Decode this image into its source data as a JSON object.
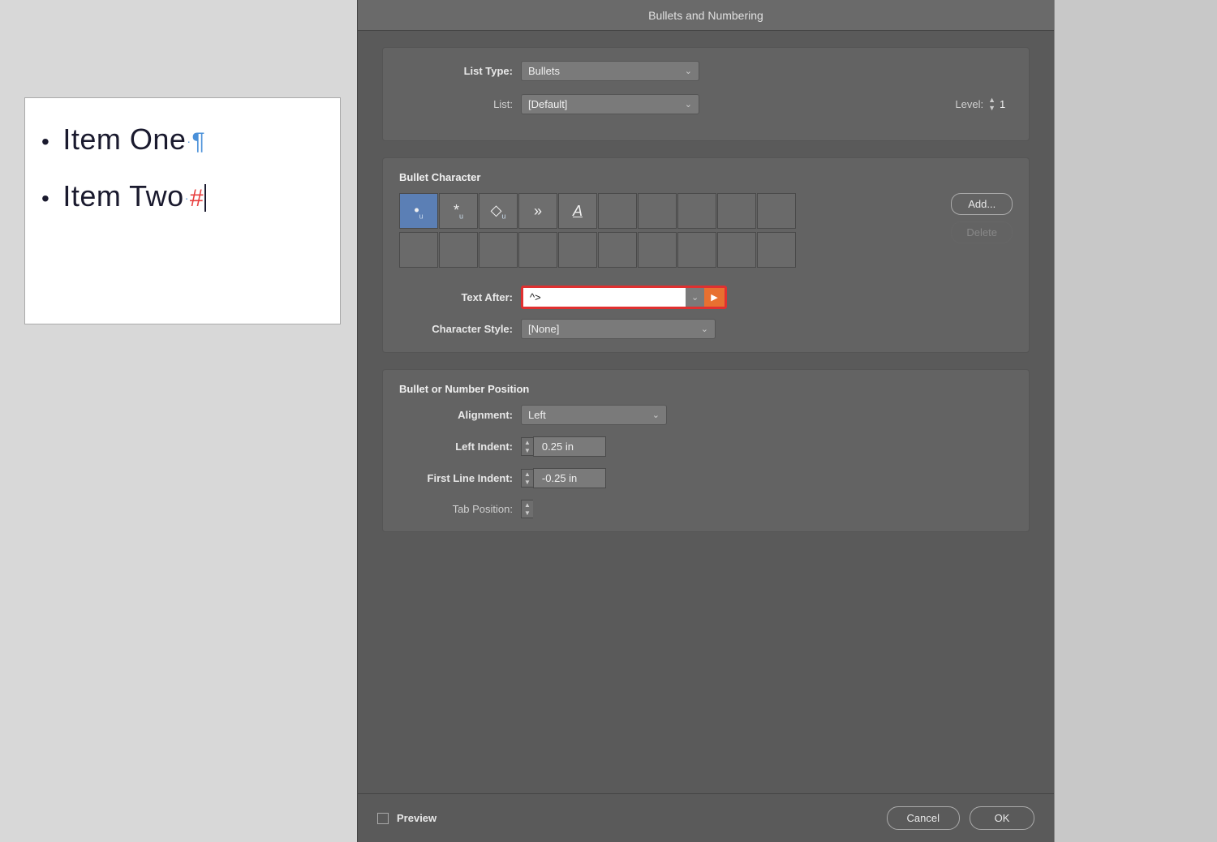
{
  "dialog": {
    "title": "Bullets and Numbering"
  },
  "listType": {
    "label": "List Type:",
    "value": "Bullets"
  },
  "list": {
    "label": "List:",
    "value": "[Default]"
  },
  "level": {
    "label": "Level:",
    "value": "1"
  },
  "bulletCharacter": {
    "title": "Bullet Character",
    "cells": [
      {
        "char": "•",
        "sub": "u",
        "active": true
      },
      {
        "char": "*",
        "sub": "u",
        "active": false
      },
      {
        "char": "◇",
        "sub": "u",
        "active": false
      },
      {
        "char": "»",
        "sub": "",
        "active": false
      },
      {
        "char": "A",
        "sub": "",
        "active": false
      },
      {
        "char": "",
        "active": false
      },
      {
        "char": "",
        "active": false
      },
      {
        "char": "",
        "active": false
      },
      {
        "char": "",
        "active": false
      },
      {
        "char": "",
        "active": false
      },
      {
        "char": "",
        "active": false
      },
      {
        "char": "",
        "active": false
      },
      {
        "char": "",
        "active": false
      },
      {
        "char": "",
        "active": false
      },
      {
        "char": "",
        "active": false
      },
      {
        "char": "",
        "active": false
      },
      {
        "char": "",
        "active": false
      },
      {
        "char": "",
        "active": false
      },
      {
        "char": "",
        "active": false
      },
      {
        "char": "",
        "active": false
      }
    ],
    "addButton": "Add...",
    "deleteButton": "Delete"
  },
  "textAfter": {
    "label": "Text After:",
    "value": "^>"
  },
  "characterStyle": {
    "label": "Character Style:",
    "value": "[None]"
  },
  "bulletPosition": {
    "title": "Bullet or Number Position",
    "alignment": {
      "label": "Alignment:",
      "value": "Left"
    },
    "leftIndent": {
      "label": "Left Indent:",
      "value": "0.25 in"
    },
    "firstLineIndent": {
      "label": "First Line Indent:",
      "value": "-0.25 in"
    },
    "tabPosition": {
      "label": "Tab Position:",
      "value": ""
    }
  },
  "footer": {
    "previewLabel": "Preview",
    "cancelLabel": "Cancel",
    "okLabel": "OK"
  },
  "document": {
    "item1": "Item One",
    "item2": "Item Two"
  }
}
